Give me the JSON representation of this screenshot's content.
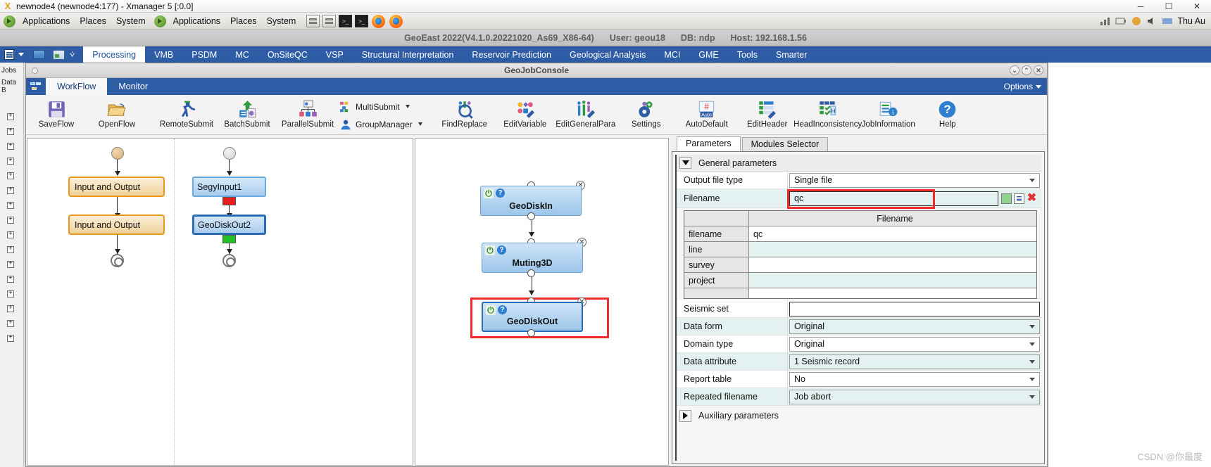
{
  "xmanager": {
    "title": "newnode4 (newnode4:177) - Xmanager 5 [:0.0]",
    "logo_glyph": "X",
    "minimize": "─",
    "maximize": "☐",
    "close": "✕"
  },
  "gnome_panel": {
    "menus_first": [
      "Applications",
      "Places",
      "System"
    ],
    "menus_second": [
      "Applications",
      "Places",
      "System"
    ],
    "terminal_glyph": ">_",
    "clock": "Thu Au"
  },
  "geoeast": {
    "status_title": "GeoEast 2022(V4.1.0.20221020_As69_X86-64)",
    "user": "User: geou18",
    "db": "DB: ndp",
    "host": "Host: 192.168.1.56",
    "menu_tabs": [
      {
        "label": "Processing",
        "active": true
      },
      {
        "label": "VMB",
        "active": false
      },
      {
        "label": "PSDM",
        "active": false
      },
      {
        "label": "MC",
        "active": false
      },
      {
        "label": "OnSiteQC",
        "active": false
      },
      {
        "label": "VSP",
        "active": false
      },
      {
        "label": "Structural Interpretation",
        "active": false
      },
      {
        "label": "Reservoir Prediction",
        "active": false
      },
      {
        "label": "Geological Analysis",
        "active": false
      },
      {
        "label": "MCI",
        "active": false
      },
      {
        "label": "GME",
        "active": false
      },
      {
        "label": "Tools",
        "active": false
      },
      {
        "label": "Smarter",
        "active": false
      }
    ],
    "rail_labels": [
      "Jobs",
      "Data B"
    ]
  },
  "jobconsole": {
    "title": "GeoJobConsole",
    "window_buttons": [
      {
        "name": "collapse",
        "glyph": "⌄"
      },
      {
        "name": "maximize",
        "glyph": "⌃"
      },
      {
        "name": "close",
        "glyph": "✕"
      }
    ],
    "tabs": [
      {
        "label": "WorkFlow",
        "active": true
      },
      {
        "label": "Monitor",
        "active": false
      }
    ],
    "options_label": "Options",
    "toolbar": {
      "group1": [
        {
          "label": "SaveFlow",
          "icon": "floppy-disk-icon"
        },
        {
          "label": "OpenFlow",
          "icon": "open-folder-icon"
        }
      ],
      "group2": [
        {
          "label": "RemoteSubmit",
          "icon": "running-person-icon"
        },
        {
          "label": "BatchSubmit",
          "icon": "upload-batch-icon"
        },
        {
          "label": "ParallelSubmit",
          "icon": "parallel-nodes-icon"
        }
      ],
      "stack": [
        {
          "label": "MultiSubmit",
          "icon": "multi-submit-icon",
          "has_caret": true
        },
        {
          "label": "GroupManager",
          "icon": "group-manager-icon",
          "has_caret": true
        }
      ],
      "group3": [
        {
          "label": "FindReplace",
          "icon": "magnifier-icon"
        },
        {
          "label": "EditVariable",
          "icon": "edit-variable-icon"
        },
        {
          "label": "EditGeneralPara",
          "icon": "edit-general-para-icon"
        },
        {
          "label": "Settings",
          "icon": "gear-icon"
        },
        {
          "label": "AutoDefault",
          "icon": "auto-default-icon"
        },
        {
          "label": "EditHeader",
          "icon": "edit-header-icon"
        },
        {
          "label": "HeadInconsistency",
          "icon": "head-inconsistency-icon"
        },
        {
          "label": "JobInformation",
          "icon": "job-information-icon"
        }
      ],
      "group4": [
        {
          "label": "Help",
          "icon": "help-question-icon"
        }
      ]
    }
  },
  "workflow_left": {
    "nodes": [
      {
        "label": "Input and Output"
      },
      {
        "label": "Input and Output"
      }
    ]
  },
  "workflow_mid_col": {
    "nodes": [
      {
        "label": "SegyInput1",
        "swatch_color": "#e81d1d"
      },
      {
        "label": "GeoDiskOut2",
        "swatch_color": "#22c022",
        "selected": true
      }
    ]
  },
  "workflow_canvas": {
    "nodes": [
      {
        "label": "GeoDiskIn",
        "selected": false,
        "highlighted": false
      },
      {
        "label": "Muting3D",
        "selected": false,
        "highlighted": false
      },
      {
        "label": "GeoDiskOut",
        "selected": true,
        "highlighted": true
      }
    ],
    "node_icons": {
      "power": "⏻",
      "help": "?",
      "close": "✕"
    }
  },
  "parameters_panel": {
    "tabs": [
      {
        "label": "Parameters",
        "active": true
      },
      {
        "label": "Modules Selector",
        "active": false
      }
    ],
    "general_section": {
      "title": "General parameters",
      "expanded": true,
      "rows": [
        {
          "label": "Output file type",
          "value": "Single file",
          "type": "combo"
        },
        {
          "label": "Filename",
          "value": "qc",
          "type": "text-with-buttons",
          "highlighted": true
        }
      ],
      "filename_buttons": [
        {
          "name": "apply-green-button",
          "glyph": ""
        },
        {
          "name": "list-button",
          "glyph": "≣"
        },
        {
          "name": "delete-red-button",
          "glyph": "✖"
        }
      ],
      "filename_table": {
        "header": [
          "",
          "Filename"
        ],
        "rows": [
          {
            "key": "filename",
            "value": "qc",
            "shade": "white"
          },
          {
            "key": "line",
            "value": "",
            "shade": "mint"
          },
          {
            "key": "survey",
            "value": "",
            "shade": "white"
          },
          {
            "key": "project",
            "value": "",
            "shade": "mint"
          }
        ]
      },
      "rows2": [
        {
          "label": "Seismic set",
          "value": "",
          "type": "text"
        },
        {
          "label": "Data form",
          "value": "Original",
          "type": "combo"
        },
        {
          "label": "Domain type",
          "value": "Original",
          "type": "combo"
        },
        {
          "label": "Data attribute",
          "value": "1 Seismic record",
          "type": "combo"
        },
        {
          "label": "Report table",
          "value": "No",
          "type": "combo"
        },
        {
          "label": "Repeated filename",
          "value": "Job abort",
          "type": "combo"
        }
      ]
    },
    "auxiliary_section": {
      "title": "Auxiliary parameters",
      "expanded": false
    }
  },
  "watermark": "CSDN @你最度",
  "colors": {
    "menu_blue": "#2f5da5",
    "highlight_red": "#ef2b2b",
    "node_blue": "#9cc6ea",
    "node_orange": "#e8971c",
    "mint_row": "#e3f2f0"
  }
}
